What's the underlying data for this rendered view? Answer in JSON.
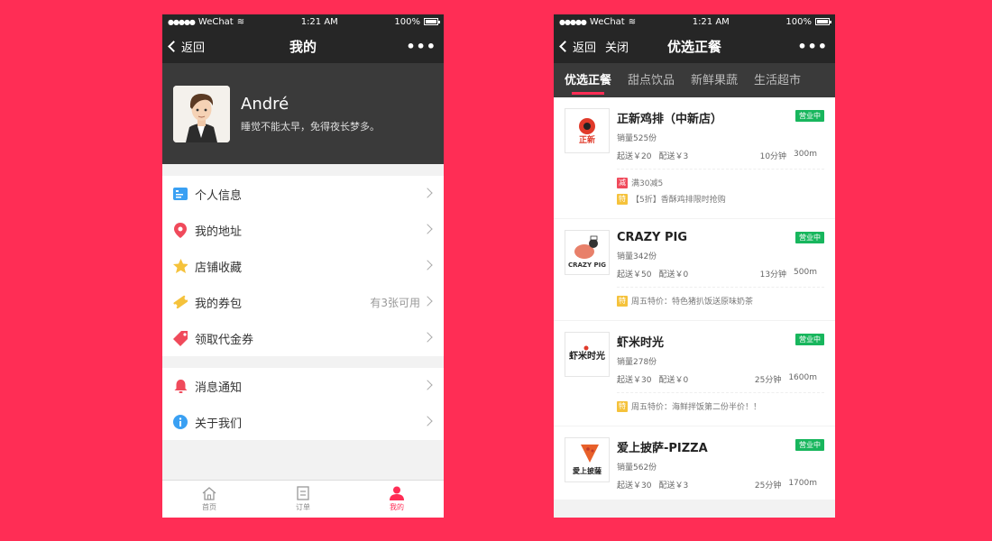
{
  "status_bar": {
    "carrier": "WeChat",
    "time": "1:21 AM",
    "battery": "100%"
  },
  "left": {
    "nav": {
      "back": "返回",
      "title": "我的",
      "more": "•••"
    },
    "profile": {
      "name": "André",
      "motto": "睡觉不能太早，免得夜长梦多。"
    },
    "menu_group_1": [
      {
        "label": "个人信息",
        "icon": "id-card-icon",
        "color": "#3aa0f3"
      },
      {
        "label": "我的地址",
        "icon": "location-pin-icon",
        "color": "#f04a5b"
      },
      {
        "label": "店铺收藏",
        "icon": "star-icon",
        "color": "#f5c23b"
      },
      {
        "label": "我的券包",
        "icon": "ticket-icon",
        "color": "#f5c23b",
        "extra": "有3张可用"
      },
      {
        "label": "领取代金券",
        "icon": "price-tag-icon",
        "color": "#f04a5b"
      }
    ],
    "menu_group_2": [
      {
        "label": "消息通知",
        "icon": "bell-icon",
        "color": "#f04a5b"
      },
      {
        "label": "关于我们",
        "icon": "info-icon",
        "color": "#3aa0f3"
      }
    ],
    "tabbar": [
      {
        "label": "首页",
        "icon": "home-icon"
      },
      {
        "label": "订单",
        "icon": "order-list-icon"
      },
      {
        "label": "我的",
        "icon": "user-icon",
        "active": true
      }
    ]
  },
  "right": {
    "nav": {
      "back": "返回",
      "close": "关闭",
      "title": "优选正餐",
      "more": "•••"
    },
    "categories": [
      "优选正餐",
      "甜点饮品",
      "新鲜果蔬",
      "生活超市"
    ],
    "shops": [
      {
        "name": "正新鸡排（中新店）",
        "sales": "销量525份",
        "min": "起送￥20",
        "delivery": "配送￥3",
        "time": "10分钟",
        "distance": "300m",
        "status": "营业中",
        "logo_text": "正新",
        "promos": [
          {
            "tag": "减",
            "type": "jian",
            "text": "满30减5"
          },
          {
            "tag": "特",
            "type": "te",
            "text": "【5折】香酥鸡排限时抢购"
          }
        ]
      },
      {
        "name": "CRAZY PIG",
        "sales": "销量342份",
        "min": "起送￥50",
        "delivery": "配送￥0",
        "time": "13分钟",
        "distance": "500m",
        "status": "营业中",
        "logo_text": "CRAZY PIG",
        "promos": [
          {
            "tag": "特",
            "type": "te",
            "text": "周五特价：特色猪扒饭送原味奶茶"
          }
        ]
      },
      {
        "name": "虾米时光",
        "sales": "销量278份",
        "min": "起送￥30",
        "delivery": "配送￥0",
        "time": "25分钟",
        "distance": "1600m",
        "status": "营业中",
        "logo_text": "虾米时光",
        "promos": [
          {
            "tag": "特",
            "type": "te",
            "text": "周五特价：海鲜拌饭第二份半价！！"
          }
        ]
      },
      {
        "name": "爱上披萨-PIZZA",
        "sales": "销量562份",
        "min": "起送￥30",
        "delivery": "配送￥3",
        "time": "25分钟",
        "distance": "1700m",
        "status": "营业中",
        "logo_text": "愛上披薩",
        "promos": []
      }
    ]
  }
}
